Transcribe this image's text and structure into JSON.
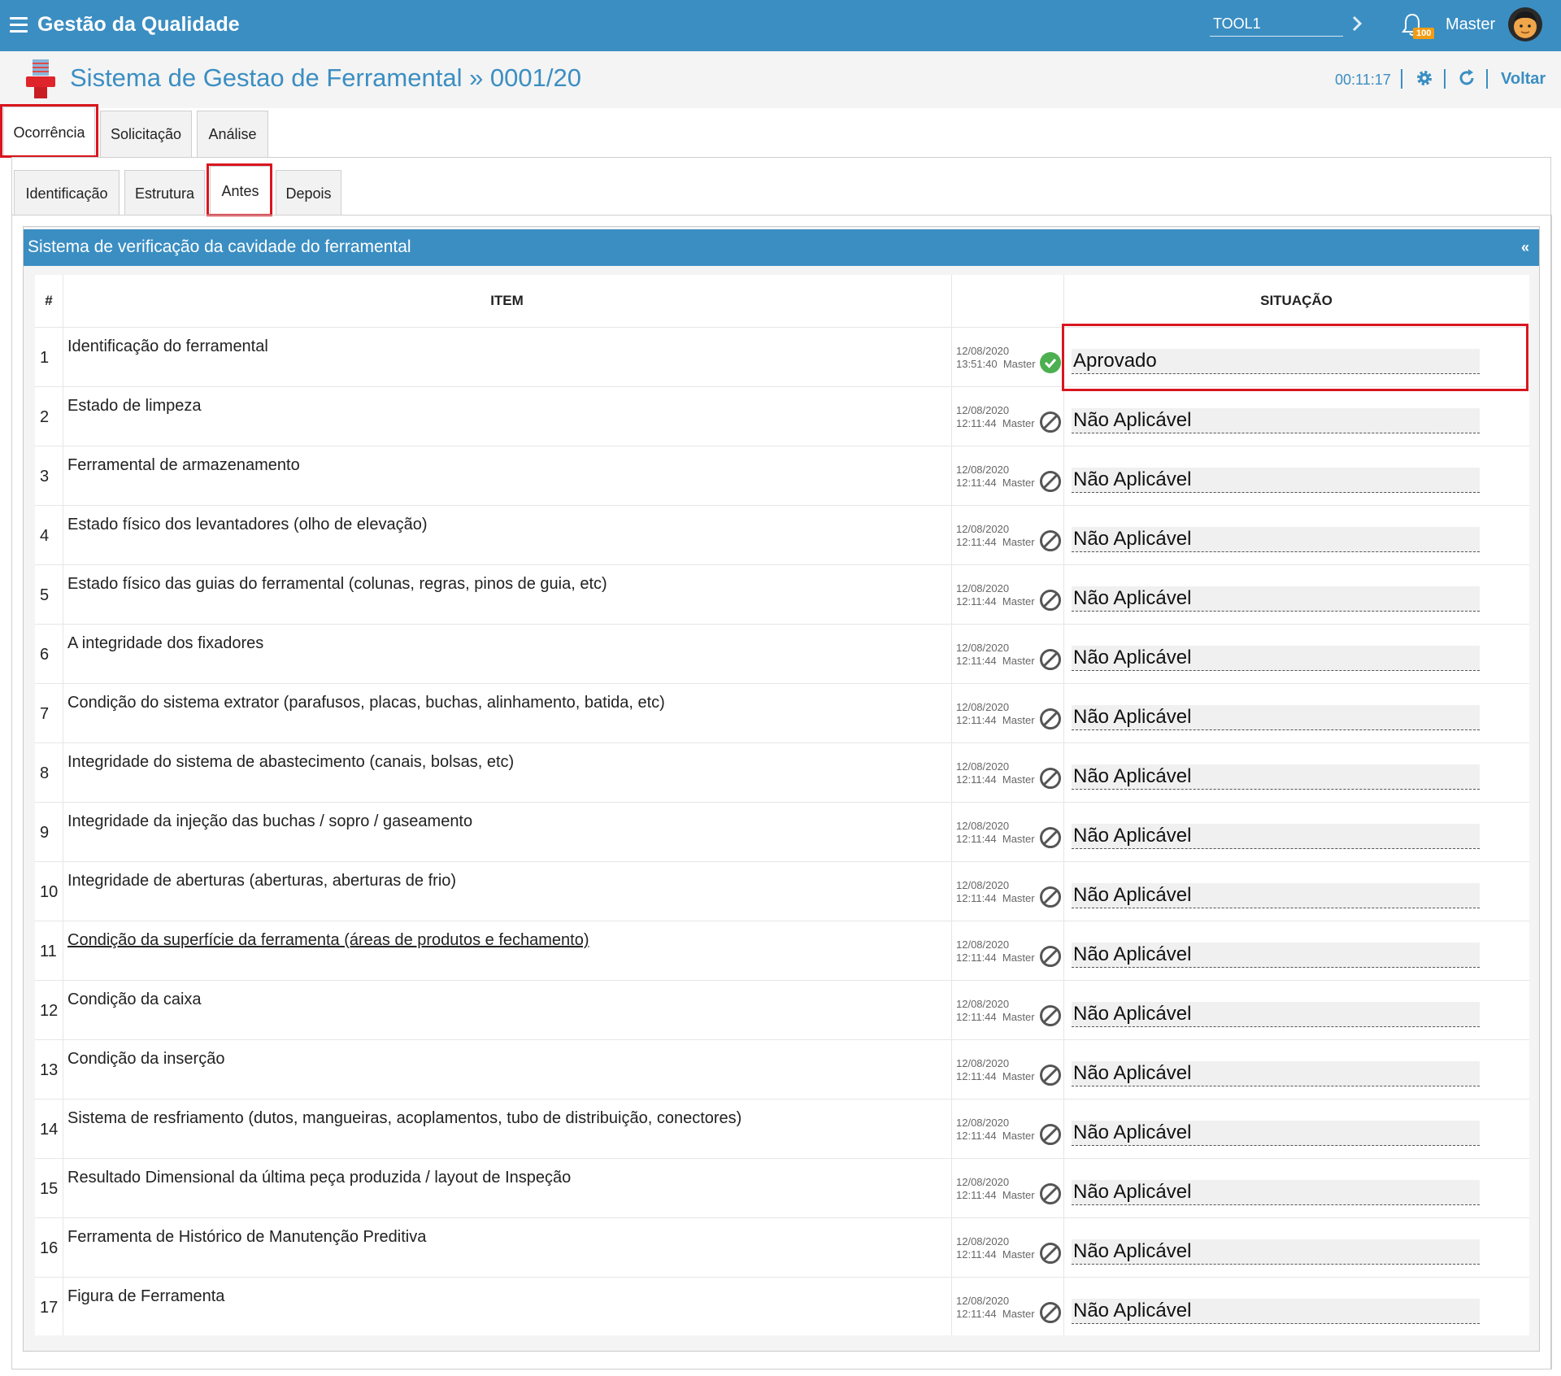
{
  "topbar": {
    "app_title": "Gestão da Qualidade",
    "tool_value": "TOOL1",
    "badge_count": "100",
    "user_name": "Master",
    "brand_color": "#3b8ec2"
  },
  "titlebar": {
    "title": "Sistema de Gestao de Ferramental » 0001/20",
    "timer": "00:11:17",
    "back_label": "Voltar"
  },
  "main_tabs": [
    {
      "label": "Ocorrência",
      "active": true
    },
    {
      "label": "Solicitação",
      "active": false
    },
    {
      "label": "Análise",
      "active": false
    }
  ],
  "sub_tabs": [
    {
      "label": "Identificação",
      "active": false
    },
    {
      "label": "Estrutura",
      "active": false
    },
    {
      "label": "Antes",
      "active": true
    },
    {
      "label": "Depois",
      "active": false
    }
  ],
  "section": {
    "title": "Sistema de verificação da cavidade do ferramental",
    "collapse_label": "«"
  },
  "table": {
    "headers": {
      "num": "#",
      "item": "ITEM",
      "situacao": "SITUAÇÃO"
    },
    "rows": [
      {
        "num": "1",
        "item": "Identificação do ferramental",
        "date": "12/08/2020",
        "time": "13:51:40",
        "user": "Master",
        "status": "Aprovado",
        "status_icon": "check-circle-icon"
      },
      {
        "num": "2",
        "item": "Estado de limpeza",
        "date": "12/08/2020",
        "time": "12:11:44",
        "user": "Master",
        "status": "Não Aplicável",
        "status_icon": "ban-icon"
      },
      {
        "num": "3",
        "item": "Ferramental de armazenamento",
        "date": "12/08/2020",
        "time": "12:11:44",
        "user": "Master",
        "status": "Não Aplicável",
        "status_icon": "ban-icon"
      },
      {
        "num": "4",
        "item": "Estado físico dos levantadores (olho de elevação)",
        "date": "12/08/2020",
        "time": "12:11:44",
        "user": "Master",
        "status": "Não Aplicável",
        "status_icon": "ban-icon"
      },
      {
        "num": "5",
        "item": "Estado físico das guias do ferramental (colunas, regras, pinos de guia, etc)",
        "date": "12/08/2020",
        "time": "12:11:44",
        "user": "Master",
        "status": "Não Aplicável",
        "status_icon": "ban-icon"
      },
      {
        "num": "6",
        "item": "A integridade dos fixadores",
        "date": "12/08/2020",
        "time": "12:11:44",
        "user": "Master",
        "status": "Não Aplicável",
        "status_icon": "ban-icon"
      },
      {
        "num": "7",
        "item": "Condição do sistema extrator (parafusos, placas, buchas, alinhamento, batida, etc)",
        "date": "12/08/2020",
        "time": "12:11:44",
        "user": "Master",
        "status": "Não Aplicável",
        "status_icon": "ban-icon"
      },
      {
        "num": "8",
        "item": "Integridade do sistema de abastecimento (canais, bolsas, etc)",
        "date": "12/08/2020",
        "time": "12:11:44",
        "user": "Master",
        "status": "Não Aplicável",
        "status_icon": "ban-icon"
      },
      {
        "num": "9",
        "item": "Integridade da injeção das buchas / sopro / gaseamento",
        "date": "12/08/2020",
        "time": "12:11:44",
        "user": "Master",
        "status": "Não Aplicável",
        "status_icon": "ban-icon"
      },
      {
        "num": "10",
        "item": "Integridade de aberturas (aberturas, aberturas de frio)",
        "date": "12/08/2020",
        "time": "12:11:44",
        "user": "Master",
        "status": "Não Aplicável",
        "status_icon": "ban-icon"
      },
      {
        "num": "11",
        "item": "Condição da superfície da ferramenta (áreas de produtos e fechamento)",
        "date": "12/08/2020",
        "time": "12:11:44",
        "user": "Master",
        "status": "Não Aplicável",
        "status_icon": "ban-icon",
        "underlined": true
      },
      {
        "num": "12",
        "item": "Condição da caixa",
        "date": "12/08/2020",
        "time": "12:11:44",
        "user": "Master",
        "status": "Não Aplicável",
        "status_icon": "ban-icon"
      },
      {
        "num": "13",
        "item": "Condição da inserção",
        "date": "12/08/2020",
        "time": "12:11:44",
        "user": "Master",
        "status": "Não Aplicável",
        "status_icon": "ban-icon"
      },
      {
        "num": "14",
        "item": "Sistema de resfriamento (dutos, mangueiras, acoplamentos, tubo de distribuição, conectores)",
        "date": "12/08/2020",
        "time": "12:11:44",
        "user": "Master",
        "status": "Não Aplicável",
        "status_icon": "ban-icon"
      },
      {
        "num": "15",
        "item": "Resultado Dimensional da última peça produzida / layout de Inspeção",
        "date": "12/08/2020",
        "time": "12:11:44",
        "user": "Master",
        "status": "Não Aplicável",
        "status_icon": "ban-icon"
      },
      {
        "num": "16",
        "item": "Ferramenta de Histórico de Manutenção Preditiva",
        "date": "12/08/2020",
        "time": "12:11:44",
        "user": "Master",
        "status": "Não Aplicável",
        "status_icon": "ban-icon"
      },
      {
        "num": "17",
        "item": "Figura de Ferramenta",
        "date": "12/08/2020",
        "time": "12:11:44",
        "user": "Master",
        "status": "Não Aplicável",
        "status_icon": "ban-icon"
      }
    ]
  },
  "colors": {
    "approved": "#4caf50",
    "not_applicable": "#555555",
    "highlight": "#d9151f"
  }
}
